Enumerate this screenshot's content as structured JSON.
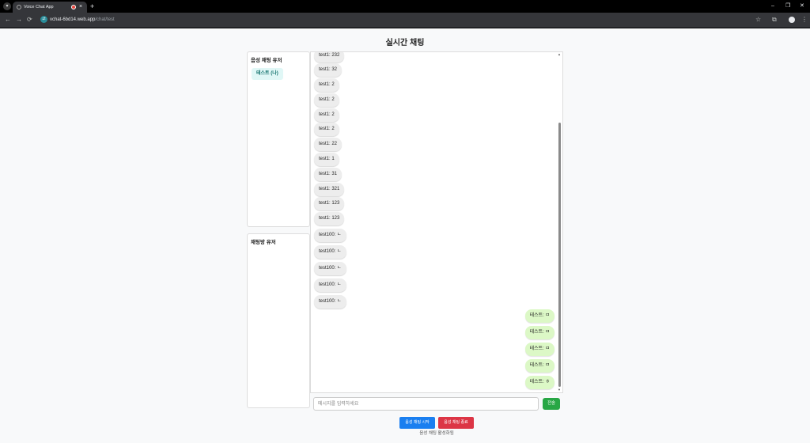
{
  "browser": {
    "tab_title": "Voice Chat App",
    "tab_close": "×",
    "new_tab": "+",
    "url_host": "vchat-6bd14.web.app",
    "url_path": "/chat/test",
    "back": "←",
    "forward": "→",
    "reload": "⟳",
    "bookmark": "☆",
    "extensions": "⧉",
    "menu": "⋮",
    "minimize": "–",
    "restore": "❐",
    "close": "✕"
  },
  "page": {
    "title": "실시간 채팅"
  },
  "voice_panel": {
    "heading": "음성 채팅 유저",
    "users": [
      "테스트 (나)"
    ]
  },
  "room_panel": {
    "heading": "채팅방 유저"
  },
  "messages": [
    {
      "sender": "test1",
      "text": "232",
      "mine": false
    },
    {
      "sender": "test1",
      "text": "32",
      "mine": false
    },
    {
      "sender": "test1",
      "text": "2",
      "mine": false
    },
    {
      "sender": "test1",
      "text": "2",
      "mine": false
    },
    {
      "sender": "test1",
      "text": "2",
      "mine": false
    },
    {
      "sender": "test1",
      "text": "2",
      "mine": false
    },
    {
      "sender": "test1",
      "text": "22",
      "mine": false
    },
    {
      "sender": "test1",
      "text": "1",
      "mine": false
    },
    {
      "sender": "test1",
      "text": "31",
      "mine": false
    },
    {
      "sender": "test1",
      "text": "321",
      "mine": false
    },
    {
      "sender": "test1",
      "text": "123",
      "mine": false
    },
    {
      "sender": "test1",
      "text": "123",
      "mine": false
    },
    {
      "sender": "test100",
      "text": "ㄴ",
      "mine": false
    },
    {
      "sender": "test100",
      "text": "ㄴ",
      "mine": false
    },
    {
      "sender": "test100",
      "text": "ㄴ",
      "mine": false
    },
    {
      "sender": "test100",
      "text": "ㄴ",
      "mine": false
    },
    {
      "sender": "test100",
      "text": "ㄴ",
      "mine": false
    },
    {
      "sender": "테스트",
      "text": "ㅁ",
      "mine": true
    },
    {
      "sender": "테스트",
      "text": "ㅁ",
      "mine": true
    },
    {
      "sender": "테스트",
      "text": "ㅁ",
      "mine": true
    },
    {
      "sender": "테스트",
      "text": "ㅁ",
      "mine": true
    },
    {
      "sender": "테스트",
      "text": "ㅎ",
      "mine": true
    }
  ],
  "input": {
    "placeholder": "메시지를 입력하세요",
    "value": "",
    "send_label": "전송"
  },
  "voice_controls": {
    "start_label": "음성 채팅 시작",
    "end_label": "음성 채팅 종료",
    "status": "음성 채팅 활성화됨"
  },
  "colors": {
    "mine_bubble": "#dcf8c6",
    "other_bubble": "#ededed",
    "send": "#28a745",
    "start": "#1a7ff0",
    "end": "#dc3545"
  }
}
